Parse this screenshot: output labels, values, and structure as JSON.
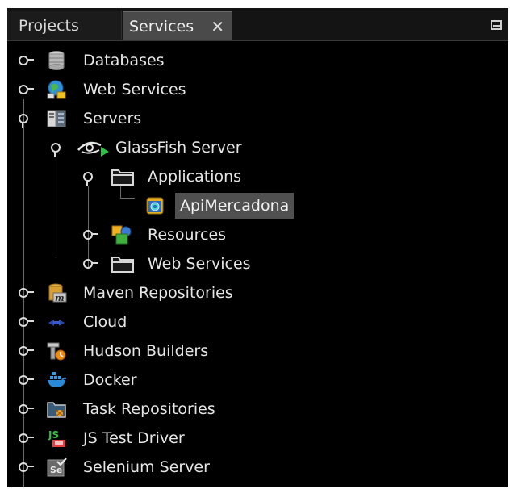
{
  "tabs": [
    {
      "label": "Projects",
      "active": false
    },
    {
      "label": "Services",
      "active": true,
      "close": "✕"
    }
  ],
  "tree": {
    "databases": {
      "label": "Databases",
      "icon": "database-icon"
    },
    "web_services": {
      "label": "Web Services",
      "icon": "web-services-icon"
    },
    "servers": {
      "label": "Servers",
      "icon": "servers-icon"
    },
    "glassfish": {
      "label": "GlassFish Server",
      "icon": "glassfish-icon"
    },
    "applications": {
      "label": "Applications",
      "icon": "folder-icon"
    },
    "api_mercadona": {
      "label": "ApiMercadona",
      "icon": "web-app-icon",
      "selected": true
    },
    "resources": {
      "label": "Resources",
      "icon": "resources-icon"
    },
    "gf_web_services": {
      "label": "Web Services",
      "icon": "folder-icon"
    },
    "maven": {
      "label": "Maven Repositories",
      "icon": "maven-icon",
      "icon_text": "m"
    },
    "cloud": {
      "label": "Cloud",
      "icon": "cloud-icon"
    },
    "hudson": {
      "label": "Hudson Builders",
      "icon": "hudson-icon"
    },
    "docker": {
      "label": "Docker",
      "icon": "docker-icon"
    },
    "task_repos": {
      "label": "Task Repositories",
      "icon": "task-repositories-icon"
    },
    "js_test": {
      "label": "JS Test Driver",
      "icon": "js-test-driver-icon",
      "icon_text": "JS"
    },
    "selenium": {
      "label": "Selenium Server",
      "icon": "selenium-icon",
      "icon_text": "Se"
    }
  },
  "colors": {
    "background": "#000000",
    "text": "#e6e6e6",
    "selection": "#505050",
    "active_tab": "#4a4a4a"
  }
}
